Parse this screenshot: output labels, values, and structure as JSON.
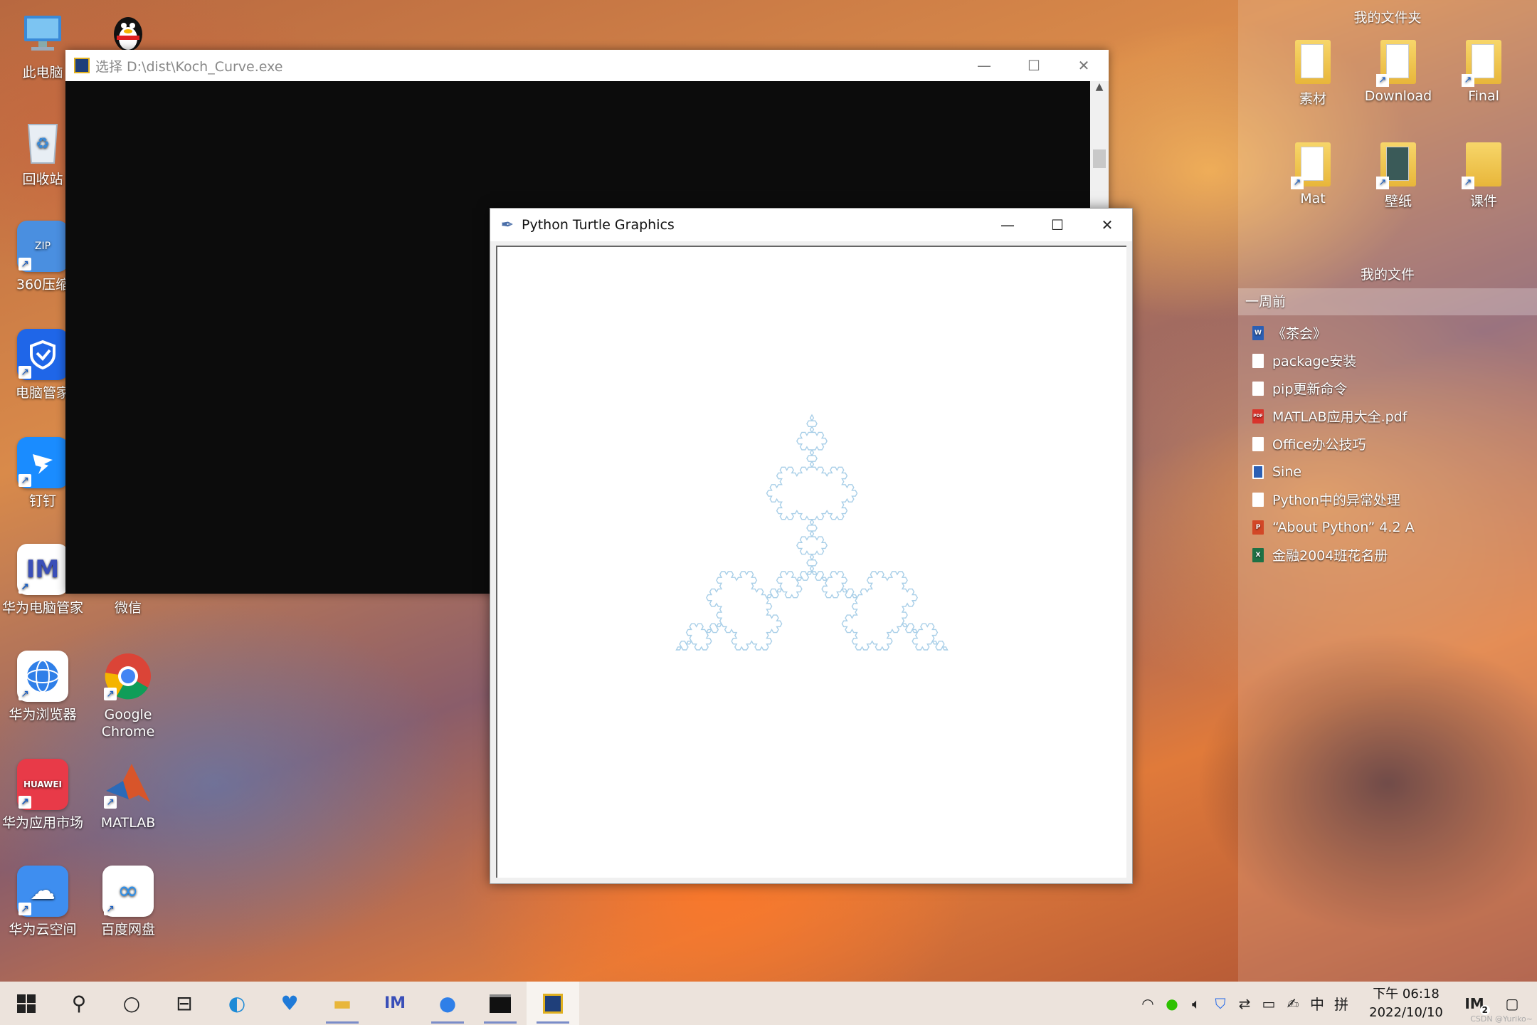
{
  "desktop_icons": [
    {
      "label": "此电脑",
      "icon": "computer-icon",
      "color": "#3a8ad8"
    },
    {
      "label": "回收站",
      "icon": "recycle-bin-icon",
      "color": "#d9e3ee"
    },
    {
      "label": "360压缩",
      "icon": "archive-icon",
      "color": "#4a8fe0"
    },
    {
      "label": "电脑管家",
      "icon": "shield-icon",
      "color": "#1f66e8"
    },
    {
      "label": "钉钉",
      "icon": "dingtalk-icon",
      "color": "#1a8cff"
    },
    {
      "label": "华为电脑管家",
      "icon": "huawei-pc-manager-icon",
      "color": "#ffffff"
    },
    {
      "label": "微信",
      "icon": "wechat-icon",
      "color": "#2dc100"
    },
    {
      "label": "华为浏览器",
      "icon": "browser-icon",
      "color": "#2f7fe8"
    },
    {
      "label": "Google Chrome",
      "icon": "chrome-icon",
      "color": "#ffffff"
    },
    {
      "label": "华为应用市场",
      "icon": "appgallery-icon",
      "color": "#e83a48"
    },
    {
      "label": "MATLAB",
      "icon": "matlab-icon",
      "color": "#d8552a"
    },
    {
      "label": "华为云空间",
      "icon": "cloud-icon",
      "color": "#3e8ef0"
    },
    {
      "label": "百度网盘",
      "icon": "baidu-netdisk-icon",
      "color": "#ffffff"
    }
  ],
  "console_window": {
    "title": "选择 D:\\dist\\Koch_Curve.exe",
    "minimize": "—",
    "maximize": "☐",
    "close": "✕"
  },
  "turtle_window": {
    "title": "Python Turtle Graphics",
    "minimize": "—",
    "maximize": "☐",
    "close": "✕",
    "curve_color": "#a9cfe8",
    "koch_order": 4
  },
  "right_panel": {
    "top_header": "我的文件夹",
    "folders": [
      "素材",
      "Download",
      "Final",
      "Mat",
      "壁纸",
      "课件"
    ],
    "mid_header": "我的文件",
    "recent_group": "一周前",
    "recent_items": [
      {
        "label": "《茶会》",
        "type": "W",
        "color": "#2b5fb4"
      },
      {
        "label": "package安装",
        "type": "",
        "color": "#ffffff"
      },
      {
        "label": "pip更新命令",
        "type": "",
        "color": "#ffffff"
      },
      {
        "label": "MATLAB应用大全.pdf",
        "type": "PDF",
        "color": "#d8342c"
      },
      {
        "label": "Office办公技巧",
        "type": "",
        "color": "#ffffff"
      },
      {
        "label": "Sine",
        "type": "",
        "color": "#ffffff"
      },
      {
        "label": "Python中的异常处理",
        "type": "",
        "color": "#ffffff"
      },
      {
        "label": "“About Python” 4.2 A",
        "type": "P",
        "color": "#d24726"
      },
      {
        "label": "金融2004班花名册",
        "type": "X",
        "color": "#1e7145"
      }
    ]
  },
  "taskbar": {
    "time": "下午 06:18",
    "date": "2022/10/10",
    "ime": "中",
    "ime2": "拼",
    "notification_count": "2",
    "watermark": "CSDN @Yuriko~"
  }
}
